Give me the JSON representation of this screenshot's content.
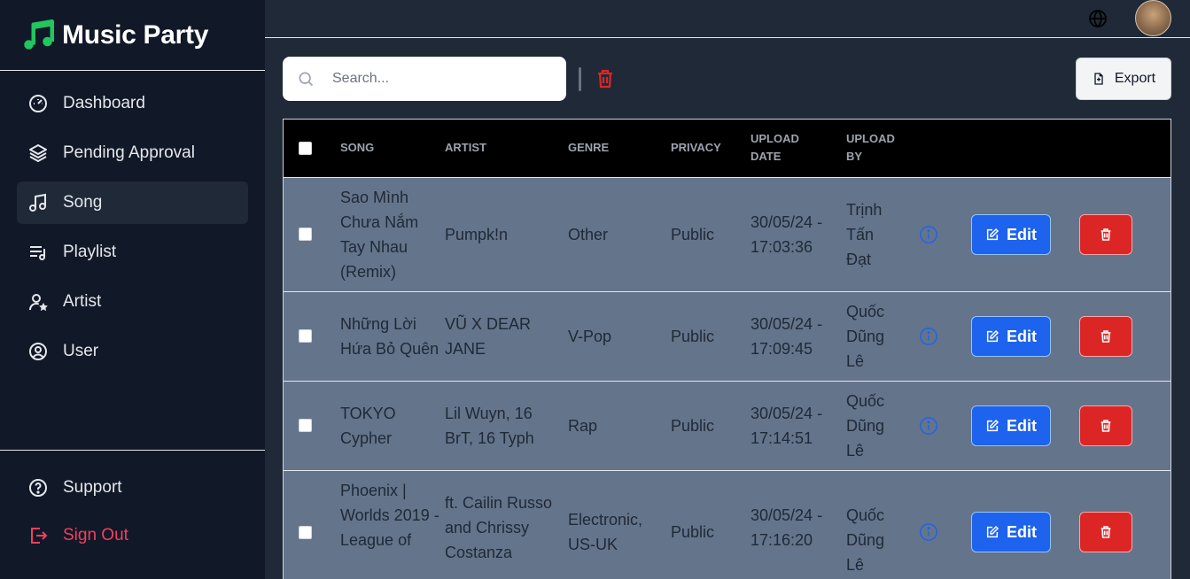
{
  "brand": {
    "name": "Music Party"
  },
  "sidebar": {
    "items": [
      {
        "label": "Dashboard",
        "icon": "dashboard-icon"
      },
      {
        "label": "Pending Approval",
        "icon": "layers-icon"
      },
      {
        "label": "Song",
        "icon": "music-note-icon",
        "active": true
      },
      {
        "label": "Playlist",
        "icon": "playlist-icon"
      },
      {
        "label": "Artist",
        "icon": "artist-icon"
      },
      {
        "label": "User",
        "icon": "user-circle-icon"
      }
    ],
    "bottom": [
      {
        "label": "Support",
        "icon": "help-circle-icon"
      },
      {
        "label": "Sign Out",
        "icon": "sign-out-icon"
      }
    ]
  },
  "toolbar": {
    "search_placeholder": "Search...",
    "export_label": "Export"
  },
  "table": {
    "headers": {
      "song": "SONG",
      "artist": "ARTIST",
      "genre": "GENRE",
      "privacy": "PRIVACY",
      "upload_date": "UPLOAD DATE",
      "upload_by": "UPLOAD BY"
    },
    "rows": [
      {
        "song": "Sao Mình Chưa Nắm Tay Nhau (Remix)",
        "artist": "Pumpk!n",
        "genre": "Other",
        "privacy": "Public",
        "date": "30/05/24 - 17:03:36",
        "by": "Trịnh Tấn Đạt",
        "edit": "Edit"
      },
      {
        "song": "Những Lời Hứa Bỏ Quên",
        "artist": "VŨ X DEAR JANE",
        "genre": "V-Pop",
        "privacy": "Public",
        "date": "30/05/24 - 17:09:45",
        "by": "Quốc Dũng Lê",
        "edit": "Edit"
      },
      {
        "song": "TOKYO Cypher",
        "artist": "Lil Wuyn, 16 BrT, 16 Typh",
        "genre": "Rap",
        "privacy": "Public",
        "date": "30/05/24 - 17:14:51",
        "by": "Quốc Dũng Lê",
        "edit": "Edit"
      },
      {
        "song": "Phoenix | Worlds 2019 - League of",
        "artist": "ft. Cailin Russo and Chrissy Costanza",
        "genre": "Electronic, US-UK",
        "privacy": "Public",
        "date": "30/05/24 - 17:16:20",
        "by": "Quốc Dũng Lê",
        "edit": "Edit"
      }
    ]
  },
  "colors": {
    "sidebar_bg": "#111827",
    "main_bg": "#1f2937",
    "row_bg": "#64748b",
    "edit_blue": "#1d63ed",
    "delete_red": "#dc2626",
    "brand_green": "#22c55e",
    "signout_red": "#f43f5e"
  }
}
